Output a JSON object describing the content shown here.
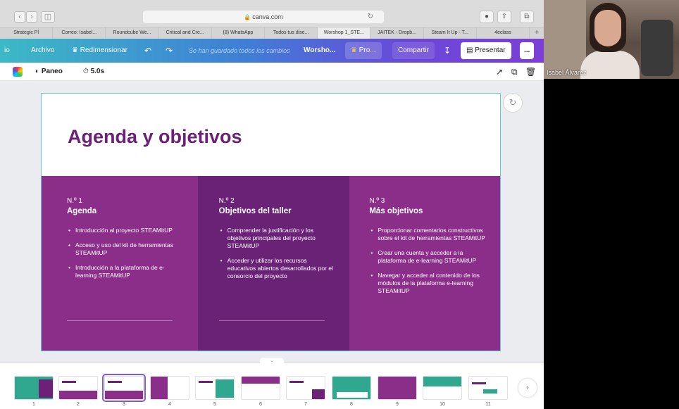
{
  "browser": {
    "url": "canva.com",
    "tabs": [
      "Strategic Pl",
      "Correo: Isabel...",
      "Roundcube We...",
      "Critical and Cre...",
      "(8) WhatsApp",
      "Todos tus dise...",
      "Worshop 1_STE...",
      "JAITEK - Dropb...",
      "Steam It Up - T...",
      "4eclass"
    ],
    "active_tab_index": 6
  },
  "canva": {
    "left_cut": "io",
    "file_menu": "Archivo",
    "resize": "Redimensionar",
    "saved_status": "Se han guardado todos los cambios",
    "doc_title": "Worsho...",
    "pro": "Pro...",
    "share": "Compartir",
    "present": "Presentar",
    "more": "..."
  },
  "toolbar": {
    "transition": "Paneo",
    "duration": "5.0s"
  },
  "slide": {
    "title": "Agenda y objetivos",
    "columns": [
      {
        "number": "N.º 1",
        "heading": "Agenda",
        "bullets": [
          "Introducción al proyecto STEAMitUP",
          "Acceso y uso del kit de herramientas STEAMitUP",
          "Introducción a la plataforma de e-learning STEAMitUP"
        ]
      },
      {
        "number": "N.º 2",
        "heading": "Objetivos del taller",
        "bullets": [
          "Comprender la justificación y los objetivos principales del proyecto STEAMitUP",
          "Acceder y utilizar los recursos educativos abiertos desarrollados por el consorcio del proyecto"
        ]
      },
      {
        "number": "N.º 3",
        "heading": "Más objetivos",
        "bullets": [
          "Proporcionar comentarios constructivos sobre el kit de herramientas STEAMitUP",
          "Crear una cuenta y acceder a la plataforma de e-learning STEAMitUP",
          "Navegar y acceder al contenido de los módulos de la plataforma e-learning STEAMitUP"
        ]
      }
    ]
  },
  "thumbnails": {
    "numbers": [
      "1",
      "2",
      "3",
      "4",
      "5",
      "6",
      "7",
      "8",
      "9",
      "10",
      "11"
    ],
    "selected_index": 2
  },
  "video": {
    "participant": "Isabel Álvarez"
  },
  "colors": {
    "brand_purple": "#6d2077",
    "column_purple": "#8b2e8a",
    "column_dark": "#6a2277",
    "selection": "#7d5ae6"
  }
}
